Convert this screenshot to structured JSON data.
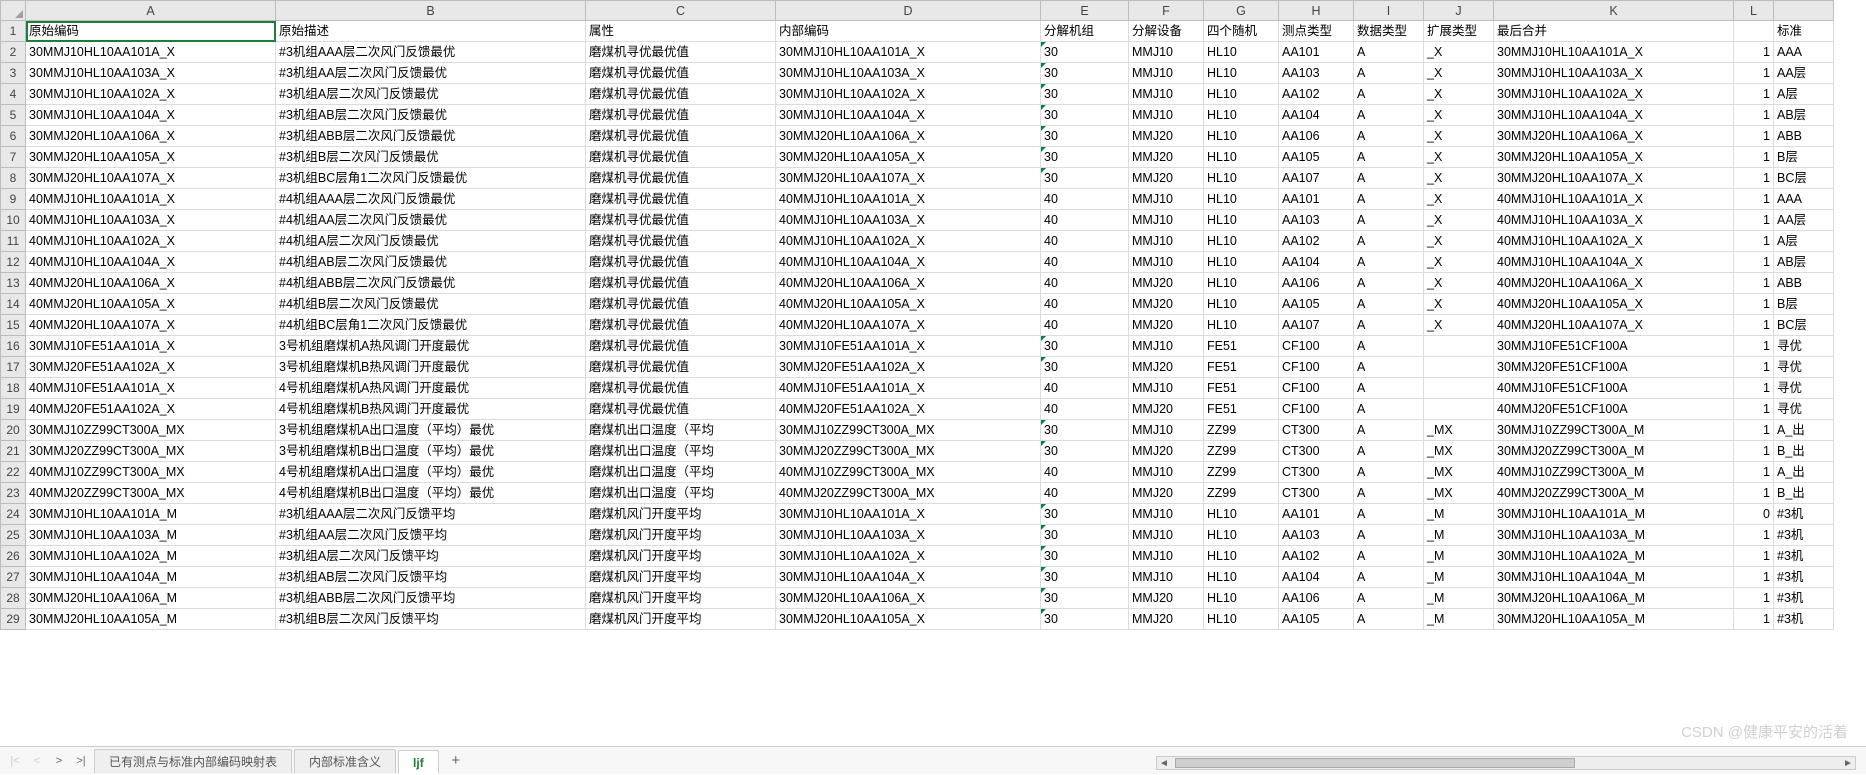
{
  "columns": [
    "A",
    "B",
    "C",
    "D",
    "E",
    "F",
    "G",
    "H",
    "I",
    "J",
    "K",
    "L"
  ],
  "headers": {
    "A": "原始编码",
    "B": "原始描述",
    "C": "属性",
    "D": "内部编码",
    "E": "分解机组",
    "F": "分解设备",
    "G": "四个随机",
    "H": "测点类型",
    "I": "数据类型",
    "J": "扩展类型",
    "K": "最后合并",
    "L": "",
    "M": "标准"
  },
  "rows": [
    {
      "A": "30MMJ10HL10AA101A_X",
      "B": "#3机组AAA层二次风门反馈最优",
      "C": "磨煤机寻优最优值",
      "D": "30MMJ10HL10AA101A_X",
      "E": "30",
      "F": "MMJ10",
      "G": "HL10",
      "H": "AA101",
      "I": "A",
      "J": "_X",
      "K": "30MMJ10HL10AA101A_X",
      "L": "1",
      "M": "AAA"
    },
    {
      "A": "30MMJ10HL10AA103A_X",
      "B": "#3机组AA层二次风门反馈最优",
      "C": "磨煤机寻优最优值",
      "D": "30MMJ10HL10AA103A_X",
      "E": "30",
      "F": "MMJ10",
      "G": "HL10",
      "H": "AA103",
      "I": "A",
      "J": "_X",
      "K": "30MMJ10HL10AA103A_X",
      "L": "1",
      "M": "AA层"
    },
    {
      "A": "30MMJ10HL10AA102A_X",
      "B": "#3机组A层二次风门反馈最优",
      "C": "磨煤机寻优最优值",
      "D": "30MMJ10HL10AA102A_X",
      "E": "30",
      "F": "MMJ10",
      "G": "HL10",
      "H": "AA102",
      "I": "A",
      "J": "_X",
      "K": "30MMJ10HL10AA102A_X",
      "L": "1",
      "M": "A层"
    },
    {
      "A": "30MMJ10HL10AA104A_X",
      "B": "#3机组AB层二次风门反馈最优",
      "C": "磨煤机寻优最优值",
      "D": "30MMJ10HL10AA104A_X",
      "E": "30",
      "F": "MMJ10",
      "G": "HL10",
      "H": "AA104",
      "I": "A",
      "J": "_X",
      "K": "30MMJ10HL10AA104A_X",
      "L": "1",
      "M": "AB层"
    },
    {
      "A": "30MMJ20HL10AA106A_X",
      "B": "#3机组ABB层二次风门反馈最优",
      "C": "磨煤机寻优最优值",
      "D": "30MMJ20HL10AA106A_X",
      "E": "30",
      "F": "MMJ20",
      "G": "HL10",
      "H": "AA106",
      "I": "A",
      "J": "_X",
      "K": "30MMJ20HL10AA106A_X",
      "L": "1",
      "M": "ABB"
    },
    {
      "A": "30MMJ20HL10AA105A_X",
      "B": "#3机组B层二次风门反馈最优",
      "C": "磨煤机寻优最优值",
      "D": "30MMJ20HL10AA105A_X",
      "E": "30",
      "F": "MMJ20",
      "G": "HL10",
      "H": "AA105",
      "I": "A",
      "J": "_X",
      "K": "30MMJ20HL10AA105A_X",
      "L": "1",
      "M": "B层"
    },
    {
      "A": "30MMJ20HL10AA107A_X",
      "B": "#3机组BC层角1二次风门反馈最优",
      "C": "磨煤机寻优最优值",
      "D": "30MMJ20HL10AA107A_X",
      "E": "30",
      "F": "MMJ20",
      "G": "HL10",
      "H": "AA107",
      "I": "A",
      "J": "_X",
      "K": "30MMJ20HL10AA107A_X",
      "L": "1",
      "M": "BC层"
    },
    {
      "A": "40MMJ10HL10AA101A_X",
      "B": "#4机组AAA层二次风门反馈最优",
      "C": "磨煤机寻优最优值",
      "D": "40MMJ10HL10AA101A_X",
      "E": "40",
      "F": "MMJ10",
      "G": "HL10",
      "H": "AA101",
      "I": "A",
      "J": "_X",
      "K": "40MMJ10HL10AA101A_X",
      "L": "1",
      "M": "AAA"
    },
    {
      "A": "40MMJ10HL10AA103A_X",
      "B": "#4机组AA层二次风门反馈最优",
      "C": "磨煤机寻优最优值",
      "D": "40MMJ10HL10AA103A_X",
      "E": "40",
      "F": "MMJ10",
      "G": "HL10",
      "H": "AA103",
      "I": "A",
      "J": "_X",
      "K": "40MMJ10HL10AA103A_X",
      "L": "1",
      "M": "AA层"
    },
    {
      "A": "40MMJ10HL10AA102A_X",
      "B": "#4机组A层二次风门反馈最优",
      "C": "磨煤机寻优最优值",
      "D": "40MMJ10HL10AA102A_X",
      "E": "40",
      "F": "MMJ10",
      "G": "HL10",
      "H": "AA102",
      "I": "A",
      "J": "_X",
      "K": "40MMJ10HL10AA102A_X",
      "L": "1",
      "M": "A层"
    },
    {
      "A": "40MMJ10HL10AA104A_X",
      "B": "#4机组AB层二次风门反馈最优",
      "C": "磨煤机寻优最优值",
      "D": "40MMJ10HL10AA104A_X",
      "E": "40",
      "F": "MMJ10",
      "G": "HL10",
      "H": "AA104",
      "I": "A",
      "J": "_X",
      "K": "40MMJ10HL10AA104A_X",
      "L": "1",
      "M": "AB层"
    },
    {
      "A": "40MMJ20HL10AA106A_X",
      "B": "#4机组ABB层二次风门反馈最优",
      "C": "磨煤机寻优最优值",
      "D": "40MMJ20HL10AA106A_X",
      "E": "40",
      "F": "MMJ20",
      "G": "HL10",
      "H": "AA106",
      "I": "A",
      "J": "_X",
      "K": "40MMJ20HL10AA106A_X",
      "L": "1",
      "M": "ABB"
    },
    {
      "A": "40MMJ20HL10AA105A_X",
      "B": "#4机组B层二次风门反馈最优",
      "C": "磨煤机寻优最优值",
      "D": "40MMJ20HL10AA105A_X",
      "E": "40",
      "F": "MMJ20",
      "G": "HL10",
      "H": "AA105",
      "I": "A",
      "J": "_X",
      "K": "40MMJ20HL10AA105A_X",
      "L": "1",
      "M": "B层"
    },
    {
      "A": "40MMJ20HL10AA107A_X",
      "B": "#4机组BC层角1二次风门反馈最优",
      "C": "磨煤机寻优最优值",
      "D": "40MMJ20HL10AA107A_X",
      "E": "40",
      "F": "MMJ20",
      "G": "HL10",
      "H": "AA107",
      "I": "A",
      "J": "_X",
      "K": "40MMJ20HL10AA107A_X",
      "L": "1",
      "M": "BC层"
    },
    {
      "A": "30MMJ10FE51AA101A_X",
      "B": "3号机组磨煤机A热风调门开度最优",
      "C": "磨煤机寻优最优值",
      "D": "30MMJ10FE51AA101A_X",
      "E": "30",
      "F": "MMJ10",
      "G": "FE51",
      "H": "CF100",
      "I": "A",
      "J": "",
      "K": "30MMJ10FE51CF100A",
      "L": "1",
      "M": "寻优"
    },
    {
      "A": "30MMJ20FE51AA102A_X",
      "B": "3号机组磨煤机B热风调门开度最优",
      "C": "磨煤机寻优最优值",
      "D": "30MMJ20FE51AA102A_X",
      "E": "30",
      "F": "MMJ20",
      "G": "FE51",
      "H": "CF100",
      "I": "A",
      "J": "",
      "K": "30MMJ20FE51CF100A",
      "L": "1",
      "M": "寻优"
    },
    {
      "A": "40MMJ10FE51AA101A_X",
      "B": "4号机组磨煤机A热风调门开度最优",
      "C": "磨煤机寻优最优值",
      "D": "40MMJ10FE51AA101A_X",
      "E": "40",
      "F": "MMJ10",
      "G": "FE51",
      "H": "CF100",
      "I": "A",
      "J": "",
      "K": "40MMJ10FE51CF100A",
      "L": "1",
      "M": "寻优"
    },
    {
      "A": "40MMJ20FE51AA102A_X",
      "B": "4号机组磨煤机B热风调门开度最优",
      "C": "磨煤机寻优最优值",
      "D": "40MMJ20FE51AA102A_X",
      "E": "40",
      "F": "MMJ20",
      "G": "FE51",
      "H": "CF100",
      "I": "A",
      "J": "",
      "K": "40MMJ20FE51CF100A",
      "L": "1",
      "M": "寻优"
    },
    {
      "A": "30MMJ10ZZ99CT300A_MX",
      "B": "3号机组磨煤机A出口温度（平均）最优",
      "C": "磨煤机出口温度（平均",
      "D": "30MMJ10ZZ99CT300A_MX",
      "E": "30",
      "F": "MMJ10",
      "G": "ZZ99",
      "H": "CT300",
      "I": "A",
      "J": "_MX",
      "K": "30MMJ10ZZ99CT300A_M",
      "L": "1",
      "M": "A_出"
    },
    {
      "A": "30MMJ20ZZ99CT300A_MX",
      "B": "3号机组磨煤机B出口温度（平均）最优",
      "C": "磨煤机出口温度（平均",
      "D": "30MMJ20ZZ99CT300A_MX",
      "E": "30",
      "F": "MMJ20",
      "G": "ZZ99",
      "H": "CT300",
      "I": "A",
      "J": "_MX",
      "K": "30MMJ20ZZ99CT300A_M",
      "L": "1",
      "M": "B_出"
    },
    {
      "A": "40MMJ10ZZ99CT300A_MX",
      "B": "4号机组磨煤机A出口温度（平均）最优",
      "C": "磨煤机出口温度（平均",
      "D": "40MMJ10ZZ99CT300A_MX",
      "E": "40",
      "F": "MMJ10",
      "G": "ZZ99",
      "H": "CT300",
      "I": "A",
      "J": "_MX",
      "K": "40MMJ10ZZ99CT300A_M",
      "L": "1",
      "M": "A_出"
    },
    {
      "A": "40MMJ20ZZ99CT300A_MX",
      "B": "4号机组磨煤机B出口温度（平均）最优",
      "C": "磨煤机出口温度（平均",
      "D": "40MMJ20ZZ99CT300A_MX",
      "E": "40",
      "F": "MMJ20",
      "G": "ZZ99",
      "H": "CT300",
      "I": "A",
      "J": "_MX",
      "K": "40MMJ20ZZ99CT300A_M",
      "L": "1",
      "M": "B_出"
    },
    {
      "A": "30MMJ10HL10AA101A_M",
      "B": "#3机组AAA层二次风门反馈平均",
      "C": "磨煤机风门开度平均",
      "D": "30MMJ10HL10AA101A_X",
      "E": "30",
      "F": "MMJ10",
      "G": "HL10",
      "H": "AA101",
      "I": "A",
      "J": "_M",
      "K": "30MMJ10HL10AA101A_M",
      "L": "0",
      "M": "#3机"
    },
    {
      "A": "30MMJ10HL10AA103A_M",
      "B": "#3机组AA层二次风门反馈平均",
      "C": "磨煤机风门开度平均",
      "D": "30MMJ10HL10AA103A_X",
      "E": "30",
      "F": "MMJ10",
      "G": "HL10",
      "H": "AA103",
      "I": "A",
      "J": "_M",
      "K": "30MMJ10HL10AA103A_M",
      "L": "1",
      "M": "#3机"
    },
    {
      "A": "30MMJ10HL10AA102A_M",
      "B": "#3机组A层二次风门反馈平均",
      "C": "磨煤机风门开度平均",
      "D": "30MMJ10HL10AA102A_X",
      "E": "30",
      "F": "MMJ10",
      "G": "HL10",
      "H": "AA102",
      "I": "A",
      "J": "_M",
      "K": "30MMJ10HL10AA102A_M",
      "L": "1",
      "M": "#3机"
    },
    {
      "A": "30MMJ10HL10AA104A_M",
      "B": "#3机组AB层二次风门反馈平均",
      "C": "磨煤机风门开度平均",
      "D": "30MMJ10HL10AA104A_X",
      "E": "30",
      "F": "MMJ10",
      "G": "HL10",
      "H": "AA104",
      "I": "A",
      "J": "_M",
      "K": "30MMJ10HL10AA104A_M",
      "L": "1",
      "M": "#3机"
    },
    {
      "A": "30MMJ20HL10AA106A_M",
      "B": "#3机组ABB层二次风门反馈平均",
      "C": "磨煤机风门开度平均",
      "D": "30MMJ20HL10AA106A_X",
      "E": "30",
      "F": "MMJ20",
      "G": "HL10",
      "H": "AA106",
      "I": "A",
      "J": "_M",
      "K": "30MMJ20HL10AA106A_M",
      "L": "1",
      "M": "#3机"
    },
    {
      "A": "30MMJ20HL10AA105A_M",
      "B": "#3机组B层二次风门反馈平均",
      "C": "磨煤机风门开度平均",
      "D": "30MMJ20HL10AA105A_X",
      "E": "30",
      "F": "MMJ20",
      "G": "HL10",
      "H": "AA105",
      "I": "A",
      "J": "_M",
      "K": "30MMJ20HL10AA105A_M",
      "L": "1",
      "M": "#3机"
    }
  ],
  "greenMarkRows30": [
    0,
    1,
    2,
    3,
    4,
    5,
    6,
    14,
    15,
    18,
    19,
    22,
    23,
    24,
    25,
    26,
    27
  ],
  "tabs": {
    "items": [
      "已有测点与标准内部编码映射表",
      "内部标准含义",
      "ljf"
    ],
    "active": 2,
    "add": "+"
  },
  "nav": {
    "first": "|<",
    "prev": "<",
    "next": ">",
    "last": ">|"
  },
  "watermark": "CSDN @健康平安的活着"
}
